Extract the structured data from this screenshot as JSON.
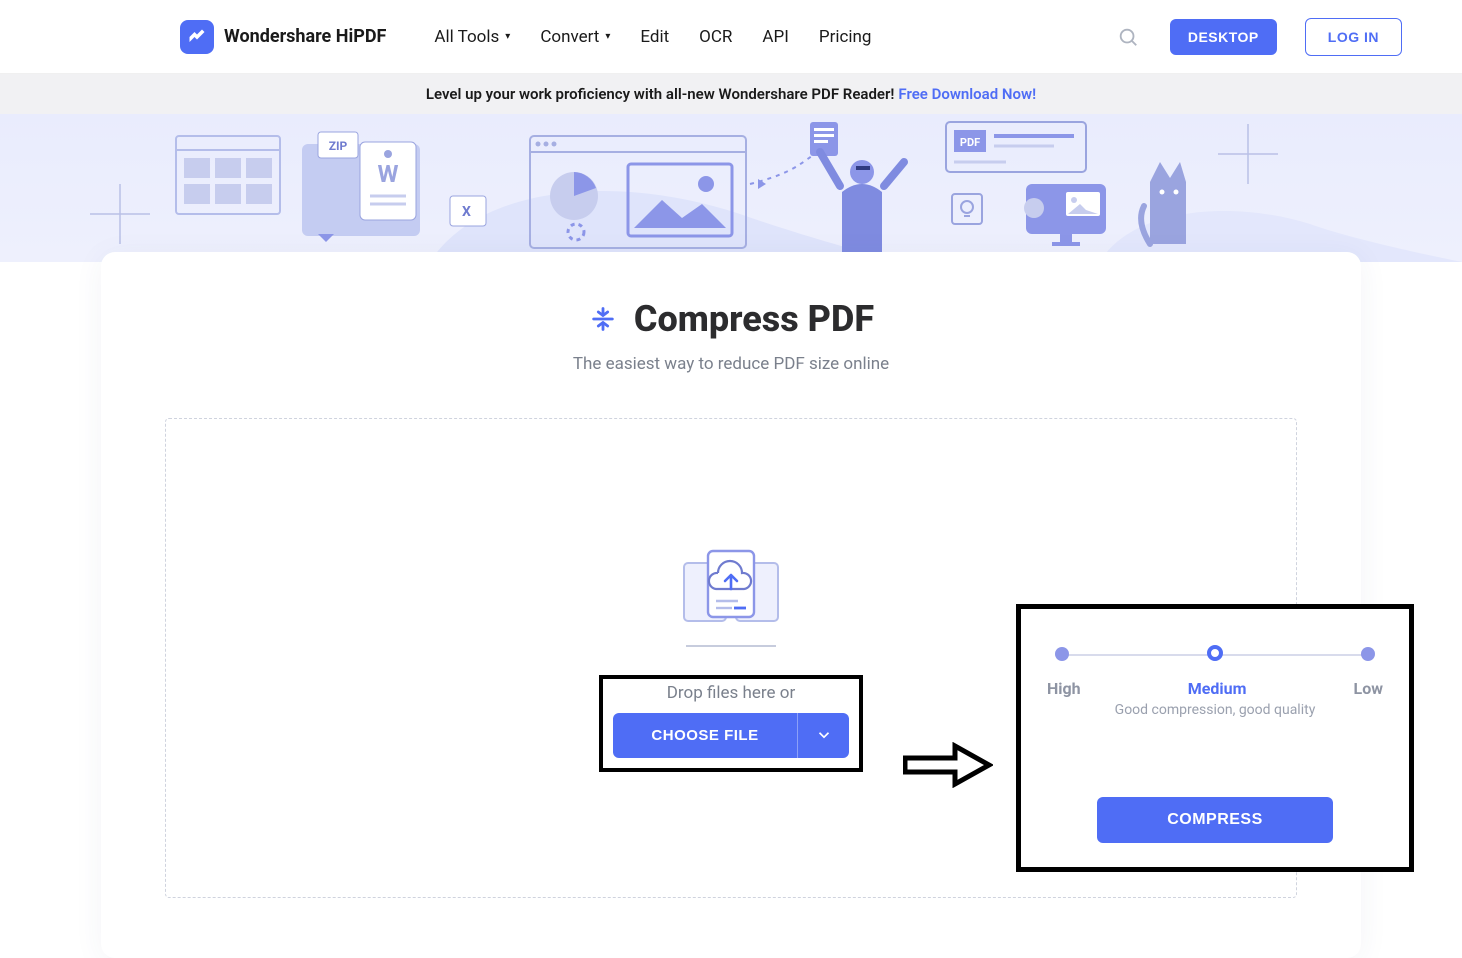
{
  "brand": "Wondershare HiPDF",
  "nav": {
    "all_tools": "All Tools",
    "convert": "Convert",
    "edit": "Edit",
    "ocr": "OCR",
    "api": "API",
    "pricing": "Pricing"
  },
  "header_buttons": {
    "desktop": "DESKTOP",
    "login": "LOG IN"
  },
  "promo": {
    "text": "Level up your work proficiency with all-new Wondershare PDF Reader!",
    "link_label": "Free Download Now!"
  },
  "page": {
    "title": "Compress PDF",
    "subtitle": "The easiest way to reduce PDF size online"
  },
  "dropzone": {
    "hint": "Drop files here or",
    "choose_label": "CHOOSE FILE"
  },
  "options": {
    "labels": {
      "high": "High",
      "medium": "Medium",
      "low": "Low"
    },
    "desc": "Good compression, good quality",
    "compress_label": "COMPRESS",
    "selected": "Medium"
  },
  "colors": {
    "primary": "#4f6df5"
  }
}
